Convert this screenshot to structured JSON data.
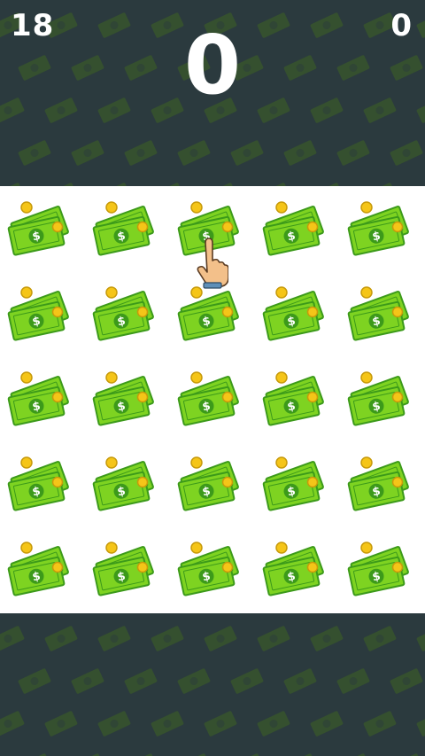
{
  "hud": {
    "left_counter": "18",
    "right_counter": "0",
    "score": "0"
  },
  "board": {
    "rows": 5,
    "columns": 5,
    "tile_icon": "cash-stack-icon"
  },
  "cursor": {
    "icon": "pointing-hand-icon"
  },
  "colors": {
    "background": "#2b3a3e",
    "pattern_bill": "#35502f",
    "board": "#ffffff",
    "bill_green": "#7ed321",
    "bill_dark": "#3c9a1a",
    "coin_gold": "#f5c518",
    "hud_text": "#ffffff"
  }
}
